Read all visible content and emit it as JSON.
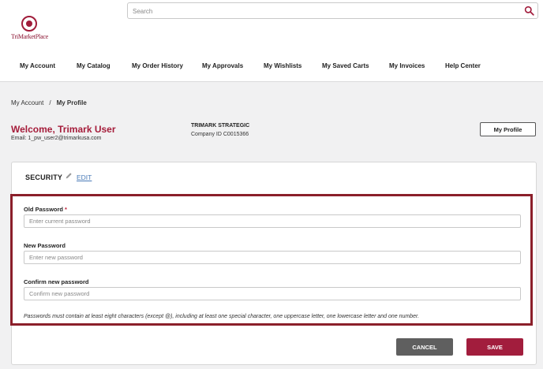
{
  "brand": {
    "name": "TriMarketPlace",
    "accent": "#a51c3a"
  },
  "search": {
    "placeholder": "Search"
  },
  "nav": {
    "items": [
      "My Account",
      "My Catalog",
      "My Order History",
      "My Approvals",
      "My Wishlists",
      "My Saved Carts",
      "My Invoices",
      "Help Center"
    ]
  },
  "breadcrumb": {
    "parent": "My Account",
    "separator": "/",
    "current": "My Profile"
  },
  "profile": {
    "welcome": "Welcome, Trimark User",
    "email": "Email: 1_pw_user2@trimarkusa.com",
    "company_name": "TRIMARK STRATEGIC",
    "company_id": "Company ID C0015366",
    "profile_button": "My Profile"
  },
  "security": {
    "title": "SECURITY",
    "edit_label": "EDIT",
    "old_password": {
      "label": "Old Password",
      "required_mark": "*",
      "placeholder": "Enter current password",
      "value": ""
    },
    "new_password": {
      "label": "New Password",
      "placeholder": "Enter new password",
      "value": ""
    },
    "confirm_password": {
      "label": "Confirm new password",
      "placeholder": "Confirm new password",
      "value": ""
    },
    "hint": "Passwords must contain at least eight characters (except @), including at least one special character, one uppercase letter, one lowercase letter and one number.",
    "cancel_label": "CANCEL",
    "save_label": "SAVE"
  }
}
